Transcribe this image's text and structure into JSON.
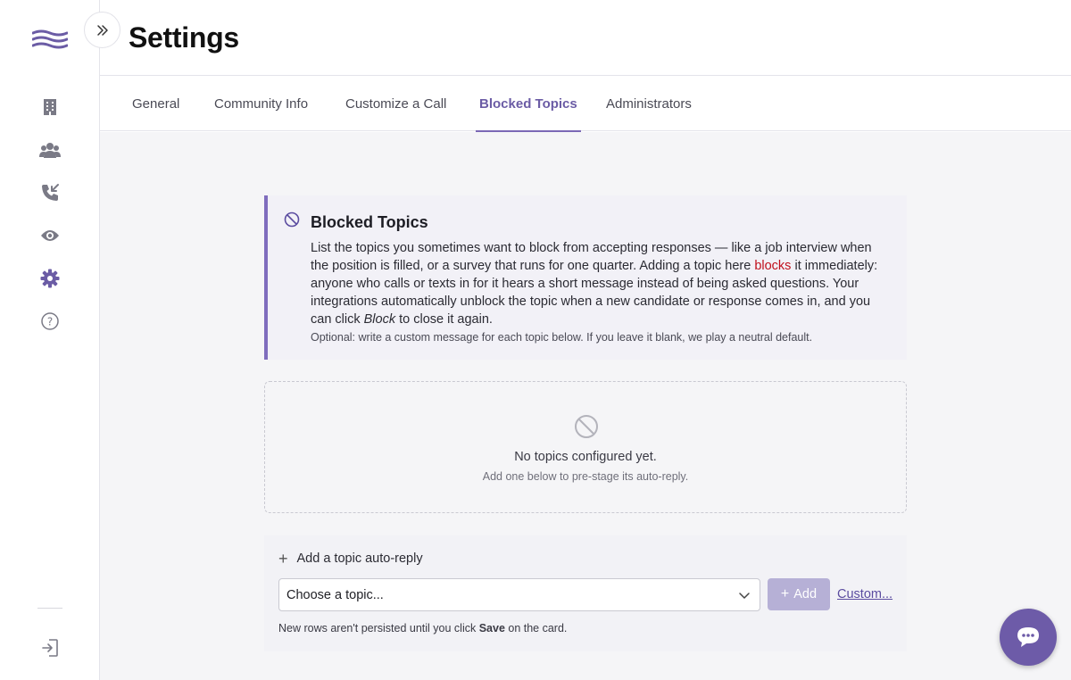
{
  "colors": {
    "accent": "#7b68b5",
    "brand_logo": "#6b5ca5",
    "sidebar_icon": "#7a7a86",
    "warning_red": "#c0101c",
    "chat_bubble": "#6d5ba8"
  },
  "sidebar": {
    "logo_icon": "waves-logo-icon",
    "items": [
      {
        "icon": "building-icon"
      },
      {
        "icon": "users-icon"
      },
      {
        "icon": "phone-incoming-icon"
      },
      {
        "icon": "eye-icon"
      },
      {
        "icon": "gear-icon",
        "active": true
      },
      {
        "icon": "help-circle-icon"
      }
    ],
    "bottom_icon": "sign-out-icon",
    "expand_icon": "chevrons-right-icon"
  },
  "header": {
    "title": "Settings"
  },
  "tabs": [
    {
      "label": "General"
    },
    {
      "label": "Community Info"
    },
    {
      "label": "Customize a Call"
    },
    {
      "label": "Blocked Topics",
      "active": true
    },
    {
      "label": "Administrators"
    }
  ],
  "info_card": {
    "icon": "block-icon",
    "title": "Blocked Topics",
    "body_part1": "List the topics you sometimes want to block from accepting responses — like a job interview when the position is filled, or a survey that runs for one quarter. Adding a topic here ",
    "body_highlight": "blocks",
    "body_part2": " it immediately: anyone who calls or texts in for it hears a short message instead of being asked questions. Your integrations automatically unblock the topic when a new candidate or response comes in, and you can click ",
    "body_emphasis": "Block",
    "body_part3": " to close it again.",
    "note": "Optional: write a custom message for each topic below. If you leave it blank, we play a neutral default."
  },
  "empty_state": {
    "icon": "block-icon",
    "title": "No topics configured yet.",
    "subtitle": "Add one below to pre-stage its auto-reply."
  },
  "add_section": {
    "header_label": "Add a topic auto-reply",
    "select_value": "Choose a topic...",
    "add_button_label": "Add",
    "custom_link": "Custom...",
    "hint_prefix": "New rows aren't persisted until you click ",
    "hint_bold": "Save",
    "hint_suffix": " on the card."
  },
  "chat": {
    "icon": "chat-bubble-icon"
  }
}
